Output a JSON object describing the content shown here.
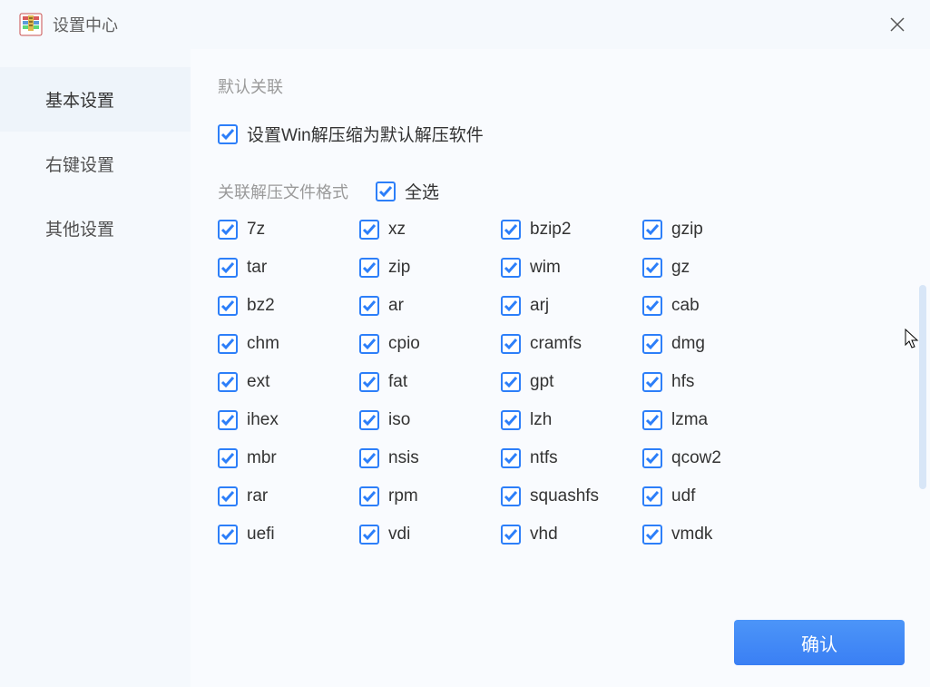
{
  "titlebar": {
    "title": "设置中心"
  },
  "sidebar": {
    "items": [
      {
        "label": "基本设置",
        "key": "basic"
      },
      {
        "label": "右键设置",
        "key": "context"
      },
      {
        "label": "其他设置",
        "key": "other"
      }
    ],
    "active": 0
  },
  "content": {
    "section_default_label": "默认关联",
    "default_checkbox_label": "设置Win解压缩为默认解压软件",
    "default_checked": true,
    "assoc_label": "关联解压文件格式",
    "select_all_label": "全选",
    "select_all_checked": true,
    "formats": [
      {
        "name": "7z",
        "checked": true
      },
      {
        "name": "xz",
        "checked": true
      },
      {
        "name": "bzip2",
        "checked": true
      },
      {
        "name": "gzip",
        "checked": true
      },
      {
        "name": "tar",
        "checked": true
      },
      {
        "name": "zip",
        "checked": true
      },
      {
        "name": "wim",
        "checked": true
      },
      {
        "name": "gz",
        "checked": true
      },
      {
        "name": "bz2",
        "checked": true
      },
      {
        "name": "ar",
        "checked": true
      },
      {
        "name": "arj",
        "checked": true
      },
      {
        "name": "cab",
        "checked": true
      },
      {
        "name": "chm",
        "checked": true
      },
      {
        "name": "cpio",
        "checked": true
      },
      {
        "name": "cramfs",
        "checked": true
      },
      {
        "name": "dmg",
        "checked": true
      },
      {
        "name": "ext",
        "checked": true
      },
      {
        "name": "fat",
        "checked": true
      },
      {
        "name": "gpt",
        "checked": true
      },
      {
        "name": "hfs",
        "checked": true
      },
      {
        "name": "ihex",
        "checked": true
      },
      {
        "name": "iso",
        "checked": true
      },
      {
        "name": "lzh",
        "checked": true
      },
      {
        "name": "lzma",
        "checked": true
      },
      {
        "name": "mbr",
        "checked": true
      },
      {
        "name": "nsis",
        "checked": true
      },
      {
        "name": "ntfs",
        "checked": true
      },
      {
        "name": "qcow2",
        "checked": true
      },
      {
        "name": "rar",
        "checked": true
      },
      {
        "name": "rpm",
        "checked": true
      },
      {
        "name": "squashfs",
        "checked": true
      },
      {
        "name": "udf",
        "checked": true
      },
      {
        "name": "uefi",
        "checked": true
      },
      {
        "name": "vdi",
        "checked": true
      },
      {
        "name": "vhd",
        "checked": true
      },
      {
        "name": "vmdk",
        "checked": true
      }
    ]
  },
  "buttons": {
    "confirm": "确认"
  }
}
